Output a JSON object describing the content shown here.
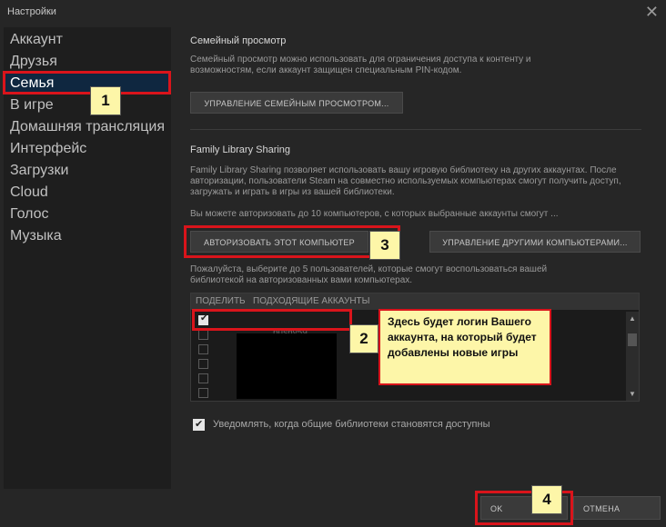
{
  "window": {
    "title": "Настройки",
    "close_glyph": "✕"
  },
  "sidebar": {
    "items": [
      "Аккаунт",
      "Друзья",
      "Семья",
      "В игре",
      "Домашняя трансляция",
      "Интерфейс",
      "Загрузки",
      "Cloud",
      "Голос",
      "Музыка"
    ],
    "active_index": 2
  },
  "family_view": {
    "heading": "Семейный просмотр",
    "text": "Семейный просмотр можно использовать для ограничения доступа к контенту и возможностям, если аккаунт защищен специальным PIN-кодом.",
    "button": "УПРАВЛЕНИЕ СЕМЕЙНЫМ ПРОСМОТРОМ..."
  },
  "library_sharing": {
    "heading": "Family Library Sharing",
    "text": "Family Library Sharing позволяет использовать вашу игровую библиотеку на других аккаунтах. После авторизации, пользователи Steam на совместно используемых компьютерах смогут получить доступ, загружать и играть в игры из вашей библиотеки.",
    "limit_text": "Вы можете авторизовать до 10 компьютеров, с которых выбранные аккаунты смогут ...",
    "authorize_button": "АВТОРИЗОВАТЬ ЭТОТ КОМПЬЮТЕР",
    "manage_button": "УПРАВЛЕНИЕ ДРУГИМИ КОМПЬЮТЕРАМИ...",
    "select_text": "Пожалуйста, выберите до 5 пользователей, которые смогут воспользоваться вашей библиотекой на авторизованных вами компьютерах.",
    "list_header_col1": "ПОДЕЛИТЬ",
    "list_header_col2": "ПОДХОДЯЩИЕ АККАУНТЫ",
    "rows": [
      {
        "checked": true,
        "name": ""
      },
      {
        "checked": false,
        "name": "pushy59"
      },
      {
        "checked": false,
        "name": ""
      },
      {
        "checked": false,
        "name": ""
      },
      {
        "checked": false,
        "name": ""
      },
      {
        "checked": false,
        "name": ""
      }
    ],
    "notify_checked": true,
    "notify_text": "Уведомлять, когда общие библиотеки становятся доступны"
  },
  "footer": {
    "ok": "OK",
    "cancel": "ОТМЕНА"
  },
  "annotations": {
    "badge1": "1",
    "badge2": "2",
    "badge3": "3",
    "badge4": "4",
    "note": "Здесь будет логин Вашего аккаунта, на который будет добавлены новые игры"
  },
  "colors": {
    "accent_red": "#d9141b",
    "note_yellow": "#fdf6a8",
    "active_bg": "#0f2740"
  }
}
